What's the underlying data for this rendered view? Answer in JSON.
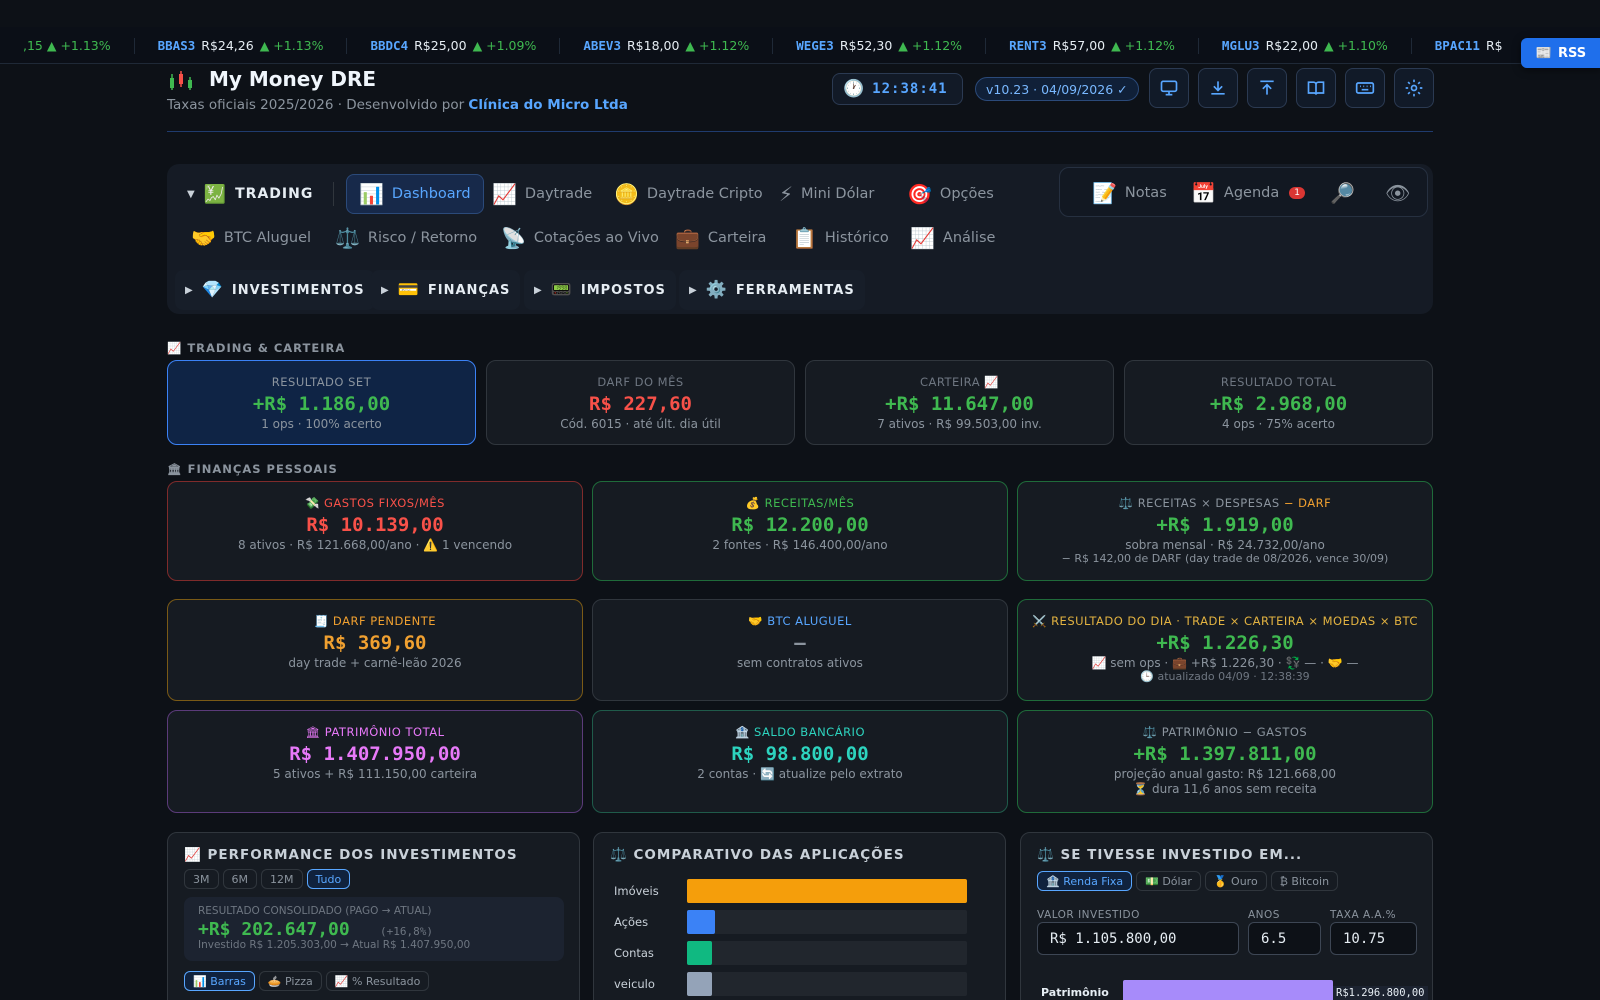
{
  "ticker": [
    {
      "symbol": "",
      "price": "",
      "change": ",15 ▲ +1.13%"
    },
    {
      "symbol": "BBAS3",
      "price": "R$24,26",
      "change": "▲ +1.13%"
    },
    {
      "symbol": "BBDC4",
      "price": "R$25,00",
      "change": "▲ +1.09%"
    },
    {
      "symbol": "ABEV3",
      "price": "R$18,00",
      "change": "▲ +1.12%"
    },
    {
      "symbol": "WEGE3",
      "price": "R$52,30",
      "change": "▲ +1.12%"
    },
    {
      "symbol": "RENT3",
      "price": "R$57,00",
      "change": "▲ +1.12%"
    },
    {
      "symbol": "MGLU3",
      "price": "R$22,00",
      "change": "▲ +1.10%"
    },
    {
      "symbol": "BPAC11",
      "price": "R$",
      "change": ""
    }
  ],
  "rss_label": "RSS",
  "header": {
    "title": "My Money DRE",
    "subtitle_prefix": "Taxas oficiais 2025/2026 · Desenvolvido por ",
    "subtitle_company": "Clínica do Micro Ltda",
    "clock": "12:38:41",
    "version": "v10.23 · 04/09/2026 ✓",
    "buttons": [
      "monitor-icon",
      "download-icon",
      "upload-icon",
      "book-icon",
      "keyboard-icon",
      "gear-icon"
    ]
  },
  "nav": {
    "trading_label": "TRADING",
    "trading_items": [
      {
        "icon": "📊",
        "label": "Dashboard"
      },
      {
        "icon": "📈",
        "label": "Daytrade"
      },
      {
        "icon": "🪙",
        "label": "Daytrade Cripto"
      },
      {
        "icon": "⚡",
        "label": "Mini Dólar"
      },
      {
        "icon": "🎯",
        "label": "Opções"
      },
      {
        "icon": "🤝",
        "label": "BTC Aluguel"
      },
      {
        "icon": "⚖️",
        "label": "Risco / Retorno"
      },
      {
        "icon": "📡",
        "label": "Cotações ao Vivo"
      },
      {
        "icon": "💼",
        "label": "Carteira"
      },
      {
        "icon": "📋",
        "label": "Histórico"
      },
      {
        "icon": "📈",
        "label": "Análise"
      }
    ],
    "groups": [
      {
        "icon": "💎",
        "label": "INVESTIMENTOS"
      },
      {
        "icon": "💳",
        "label": "FINANÇAS"
      },
      {
        "icon": "📟",
        "label": "IMPOSTOS"
      },
      {
        "icon": "⚙️",
        "label": "FERRAMENTAS"
      }
    ],
    "tools": {
      "notes": "Notas",
      "agenda": "Agenda",
      "agenda_badge": "1"
    }
  },
  "sections": {
    "trading": "📈 TRADING & CARTEIRA",
    "finance": "🏛 FINANÇAS PESSOAIS"
  },
  "trading_cards": [
    {
      "label": "RESULTADO SET",
      "value": "+R$ 1.186,00",
      "sub": "1 ops · 100% acerto"
    },
    {
      "label": "DARF DO MÊS",
      "value": "R$ 227,60",
      "sub": "Cód. 6015 · até últ. dia útil"
    },
    {
      "label": "CARTEIRA 📈",
      "value": "+R$ 11.647,00",
      "sub": "7 ativos · R$ 99.503,00 inv."
    },
    {
      "label": "RESULTADO TOTAL",
      "value": "+R$ 2.968,00",
      "sub": "4 ops · 75% acerto"
    }
  ],
  "finance_cards": [
    {
      "label": "💸 GASTOS FIXOS/MÊS",
      "value": "R$ 10.139,00",
      "sub": "8 ativos · R$ 121.668,00/ano · ⚠️ 1 vencendo",
      "sub2": ""
    },
    {
      "label": "💰 RECEITAS/MÊS",
      "value": "R$ 12.200,00",
      "sub": "2 fontes · R$ 146.400,00/ano",
      "sub2": ""
    },
    {
      "label": "⚖️ RECEITAS × DESPESAS",
      "label_extra": "− DARF",
      "value": "+R$ 1.919,00",
      "sub": "sobra mensal · R$ 24.732,00/ano",
      "sub2": "− R$ 142,00 de DARF (day trade de 08/2026, vence 30/09)"
    },
    {
      "label": "🧾 DARF PENDENTE",
      "value": "R$ 369,60",
      "sub": "day trade + carnê-leão 2026",
      "sub2": ""
    },
    {
      "label": "🤝 BTC ALUGUEL",
      "value": "—",
      "sub": "sem contratos ativos",
      "sub2": ""
    },
    {
      "label": "⚔️ RESULTADO DO DIA · TRADE × CARTEIRA × MOEDAS × BTC",
      "value": "+R$ 1.226,30",
      "sub": "📈 sem ops · 💼 +R$ 1.226,30 · 💱 — · 🤝 —",
      "sub2": "🕒 atualizado 04/09 · 12:38:39"
    },
    {
      "label": "🏛 PATRIMÔNIO TOTAL",
      "value": "R$ 1.407.950,00",
      "sub": "5 ativos + R$ 111.150,00 carteira",
      "sub2": ""
    },
    {
      "label": "🏦 SALDO BANCÁRIO",
      "value": "R$ 98.800,00",
      "sub": "2 contas · 🔄 atualize pelo extrato",
      "sub2": ""
    },
    {
      "label": "⚖️ PATRIMÔNIO − GASTOS",
      "value": "+R$ 1.397.811,00",
      "sub": "projeção anual gasto: R$ 121.668,00",
      "sub2": "⏳ dura 11,6 anos sem receita"
    }
  ],
  "performance": {
    "title": "📈 PERFORMANCE DOS INVESTIMENTOS",
    "ranges": [
      "3M",
      "6M",
      "12M",
      "Tudo"
    ],
    "result_label": "RESULTADO CONSOLIDADO (PAGO → ATUAL)",
    "result_value": "+R$ 202.647,00",
    "result_pct": "(+16,8%)",
    "result_sub": "Investido R$ 1.205.303,00 → Atual R$ 1.407.950,00",
    "views": [
      "📊 Barras",
      "🥧 Pizza",
      "📈 % Resultado"
    ]
  },
  "comparison": {
    "title": "⚖️ COMPARATIVO DAS APLICAÇÕES",
    "colors": [
      "#f59e0b",
      "#3b82f6",
      "#10b981",
      "#94a3b8"
    ]
  },
  "chart_data": {
    "type": "bar",
    "categories": [
      "Imóveis",
      "Ações",
      "Contas",
      "veiculo"
    ],
    "values": [
      1000,
      100,
      88,
      88
    ],
    "xlabel": "",
    "ylabel": "",
    "title": ""
  },
  "whatif": {
    "title": "⚖️ SE TIVESSE INVESTIDO EM...",
    "options": [
      "🏦 Renda Fixa",
      "💵 Dólar",
      "🥇 Ouro",
      "₿ Bitcoin"
    ],
    "amount_label": "VALOR INVESTIDO",
    "amount_value": "R$ 1.105.800,00",
    "years_label": "ANOS",
    "years_value": "6.5",
    "rate_label": "TAXA A.A.%",
    "rate_value": "10.75",
    "bar_label": "Patrimônio",
    "bar_value": "R$1.296.800,00",
    "bar_fill": 0.62
  }
}
